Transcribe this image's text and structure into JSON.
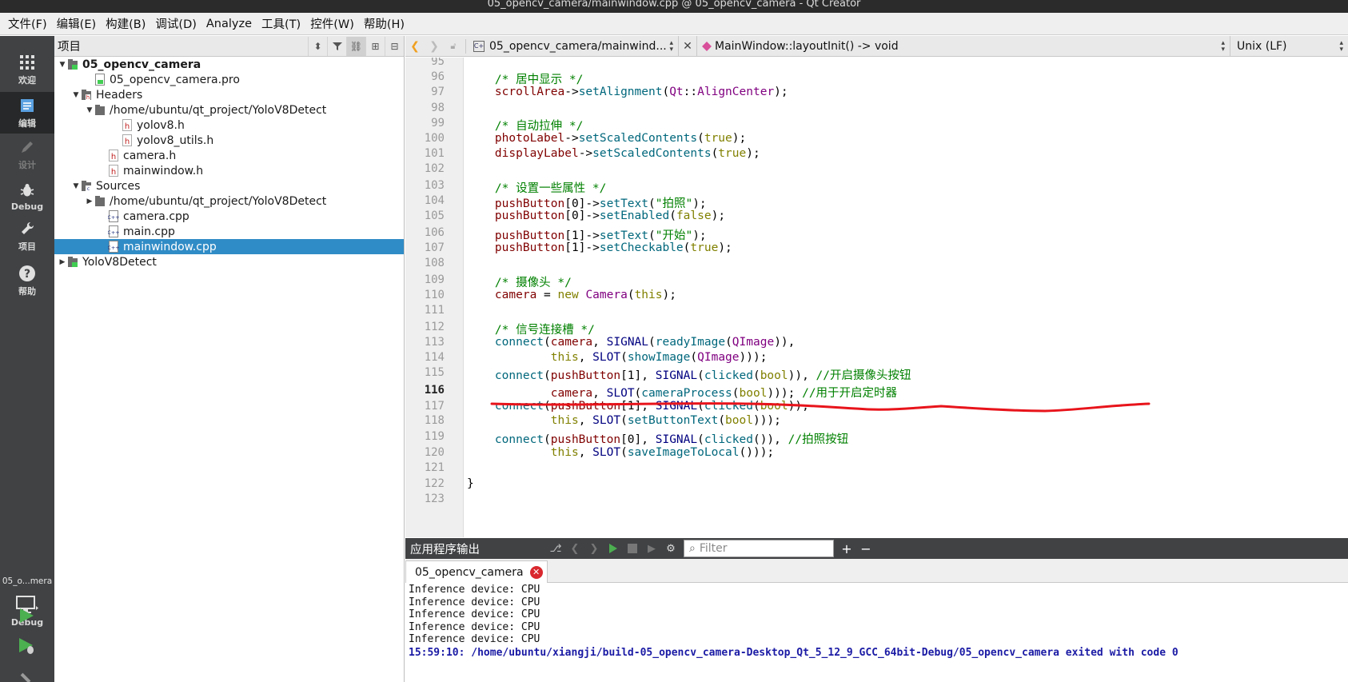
{
  "window": {
    "title": "05_opencv_camera/mainwindow.cpp @ 05_opencv_camera - Qt Creator"
  },
  "menubar": [
    "文件(F)",
    "编辑(E)",
    "构建(B)",
    "调试(D)",
    "Analyze",
    "工具(T)",
    "控件(W)",
    "帮助(H)"
  ],
  "modes": [
    {
      "label": "欢迎",
      "icon": "grid-icon"
    },
    {
      "label": "编辑",
      "icon": "document-icon"
    },
    {
      "label": "设计",
      "icon": "pencil-icon"
    },
    {
      "label": "Debug",
      "icon": "bug-icon"
    },
    {
      "label": "项目",
      "icon": "wrench-icon"
    },
    {
      "label": "帮助",
      "icon": "help-icon"
    }
  ],
  "kit": {
    "name": "05_o...mera",
    "mode": "Debug"
  },
  "project_panel": {
    "title": "项目",
    "tree": [
      {
        "text": "05_opencv_camera",
        "depth": 0,
        "arrow": "down",
        "icon": "project",
        "bold": true
      },
      {
        "text": "05_opencv_camera.pro",
        "depth": 2,
        "arrow": "",
        "icon": "pro"
      },
      {
        "text": "Headers",
        "depth": 1,
        "arrow": "down",
        "icon": "folder-h"
      },
      {
        "text": "/home/ubuntu/qt_project/YoloV8Detect",
        "depth": 2,
        "arrow": "down",
        "icon": "folder"
      },
      {
        "text": "yolov8.h",
        "depth": 4,
        "arrow": "",
        "icon": "h"
      },
      {
        "text": "yolov8_utils.h",
        "depth": 4,
        "arrow": "",
        "icon": "h"
      },
      {
        "text": "camera.h",
        "depth": 3,
        "arrow": "",
        "icon": "h"
      },
      {
        "text": "mainwindow.h",
        "depth": 3,
        "arrow": "",
        "icon": "h"
      },
      {
        "text": "Sources",
        "depth": 1,
        "arrow": "down",
        "icon": "folder-cpp"
      },
      {
        "text": "/home/ubuntu/qt_project/YoloV8Detect",
        "depth": 2,
        "arrow": "right",
        "icon": "folder"
      },
      {
        "text": "camera.cpp",
        "depth": 3,
        "arrow": "",
        "icon": "cpp"
      },
      {
        "text": "main.cpp",
        "depth": 3,
        "arrow": "",
        "icon": "cpp"
      },
      {
        "text": "mainwindow.cpp",
        "depth": 3,
        "arrow": "",
        "icon": "cpp",
        "selected": true
      },
      {
        "text": "YoloV8Detect",
        "depth": 0,
        "arrow": "right",
        "icon": "project"
      }
    ]
  },
  "editor": {
    "file": "05_opencv_camera/mainwind...",
    "symbol": "MainWindow::layoutInit() -> void",
    "line_ending": "Unix (LF)",
    "current_line": 116,
    "lines": [
      {
        "n": 95,
        "parts": []
      },
      {
        "n": 96,
        "parts": [
          [
            "    ",
            ""
          ],
          [
            "/* 居中显示 */",
            "comment"
          ]
        ]
      },
      {
        "n": 97,
        "parts": [
          [
            "    ",
            ""
          ],
          [
            "scrollArea",
            "member"
          ],
          [
            "->",
            ""
          ],
          [
            "setAlignment",
            "func"
          ],
          [
            "(",
            ""
          ],
          [
            "Qt",
            "ns"
          ],
          [
            "::",
            ""
          ],
          [
            "AlignCenter",
            "enum"
          ],
          [
            ");",
            ""
          ]
        ]
      },
      {
        "n": 98,
        "parts": []
      },
      {
        "n": 99,
        "parts": [
          [
            "    ",
            ""
          ],
          [
            "/* 自动拉伸 */",
            "comment"
          ]
        ]
      },
      {
        "n": 100,
        "parts": [
          [
            "    ",
            ""
          ],
          [
            "photoLabel",
            "member"
          ],
          [
            "->",
            ""
          ],
          [
            "setScaledContents",
            "func"
          ],
          [
            "(",
            ""
          ],
          [
            "true",
            "kw"
          ],
          [
            ");",
            ""
          ]
        ]
      },
      {
        "n": 101,
        "parts": [
          [
            "    ",
            ""
          ],
          [
            "displayLabel",
            "member"
          ],
          [
            "->",
            ""
          ],
          [
            "setScaledContents",
            "func"
          ],
          [
            "(",
            ""
          ],
          [
            "true",
            "kw"
          ],
          [
            ");",
            ""
          ]
        ]
      },
      {
        "n": 102,
        "parts": []
      },
      {
        "n": 103,
        "parts": [
          [
            "    ",
            ""
          ],
          [
            "/* 设置一些属性 */",
            "comment"
          ]
        ]
      },
      {
        "n": 104,
        "parts": [
          [
            "    ",
            ""
          ],
          [
            "pushButton",
            "member"
          ],
          [
            "[0]->",
            ""
          ],
          [
            "setText",
            "func"
          ],
          [
            "(",
            ""
          ],
          [
            "\"拍照\"",
            "str"
          ],
          [
            ");",
            ""
          ]
        ]
      },
      {
        "n": 105,
        "parts": [
          [
            "    ",
            ""
          ],
          [
            "pushButton",
            "member"
          ],
          [
            "[0]->",
            ""
          ],
          [
            "setEnabled",
            "func"
          ],
          [
            "(",
            ""
          ],
          [
            "false",
            "kw"
          ],
          [
            ");",
            ""
          ]
        ]
      },
      {
        "n": 106,
        "parts": [
          [
            "    ",
            ""
          ],
          [
            "pushButton",
            "member"
          ],
          [
            "[1]->",
            ""
          ],
          [
            "setText",
            "func"
          ],
          [
            "(",
            ""
          ],
          [
            "\"开始\"",
            "str"
          ],
          [
            ");",
            ""
          ]
        ]
      },
      {
        "n": 107,
        "parts": [
          [
            "    ",
            ""
          ],
          [
            "pushButton",
            "member"
          ],
          [
            "[1]->",
            ""
          ],
          [
            "setCheckable",
            "func"
          ],
          [
            "(",
            ""
          ],
          [
            "true",
            "kw"
          ],
          [
            ");",
            ""
          ]
        ]
      },
      {
        "n": 108,
        "parts": []
      },
      {
        "n": 109,
        "parts": [
          [
            "    ",
            ""
          ],
          [
            "/* 摄像头 */",
            "comment"
          ]
        ]
      },
      {
        "n": 110,
        "parts": [
          [
            "    ",
            ""
          ],
          [
            "camera",
            "member"
          ],
          [
            " = ",
            ""
          ],
          [
            "new",
            "kw"
          ],
          [
            " ",
            ""
          ],
          [
            "Camera",
            "type"
          ],
          [
            "(",
            ""
          ],
          [
            "this",
            "kw"
          ],
          [
            ");",
            ""
          ]
        ]
      },
      {
        "n": 111,
        "parts": []
      },
      {
        "n": 112,
        "parts": [
          [
            "    ",
            ""
          ],
          [
            "/* 信号连接槽 */",
            "comment"
          ]
        ]
      },
      {
        "n": 113,
        "parts": [
          [
            "    ",
            ""
          ],
          [
            "connect",
            "func"
          ],
          [
            "(",
            ""
          ],
          [
            "camera",
            "member"
          ],
          [
            ", ",
            ""
          ],
          [
            "SIGNAL",
            "macro"
          ],
          [
            "(",
            ""
          ],
          [
            "readyImage",
            "func"
          ],
          [
            "(",
            ""
          ],
          [
            "QImage",
            "type"
          ],
          [
            ")),",
            ""
          ]
        ]
      },
      {
        "n": 114,
        "parts": [
          [
            "            ",
            ""
          ],
          [
            "this",
            "kw"
          ],
          [
            ", ",
            ""
          ],
          [
            "SLOT",
            "macro"
          ],
          [
            "(",
            ""
          ],
          [
            "showImage",
            "func"
          ],
          [
            "(",
            ""
          ],
          [
            "QImage",
            "type"
          ],
          [
            ")));",
            ""
          ]
        ]
      },
      {
        "n": 115,
        "parts": [
          [
            "    ",
            ""
          ],
          [
            "connect",
            "func"
          ],
          [
            "(",
            ""
          ],
          [
            "pushButton",
            "member"
          ],
          [
            "[1], ",
            ""
          ],
          [
            "SIGNAL",
            "macro"
          ],
          [
            "(",
            ""
          ],
          [
            "clicked",
            "func"
          ],
          [
            "(",
            ""
          ],
          [
            "bool",
            "kw"
          ],
          [
            ")), ",
            ""
          ],
          [
            "//开启摄像头按钮",
            "comment"
          ]
        ]
      },
      {
        "n": 116,
        "parts": [
          [
            "            ",
            ""
          ],
          [
            "camera",
            "member"
          ],
          [
            ", ",
            ""
          ],
          [
            "SLOT",
            "macro"
          ],
          [
            "(",
            ""
          ],
          [
            "cameraProcess",
            "func"
          ],
          [
            "(",
            ""
          ],
          [
            "bool",
            "kw"
          ],
          [
            ")));",
            ""
          ],
          [
            " ",
            ""
          ],
          [
            "//用于开启定时器",
            "comment"
          ]
        ]
      },
      {
        "n": 117,
        "parts": [
          [
            "    ",
            ""
          ],
          [
            "connect",
            "func"
          ],
          [
            "(",
            ""
          ],
          [
            "pushButton",
            "member"
          ],
          [
            "[1], ",
            ""
          ],
          [
            "SIGNAL",
            "macro"
          ],
          [
            "(",
            ""
          ],
          [
            "clicked",
            "func"
          ],
          [
            "(",
            ""
          ],
          [
            "bool",
            "kw"
          ],
          [
            ")),",
            ""
          ]
        ]
      },
      {
        "n": 118,
        "parts": [
          [
            "            ",
            ""
          ],
          [
            "this",
            "kw"
          ],
          [
            ", ",
            ""
          ],
          [
            "SLOT",
            "macro"
          ],
          [
            "(",
            ""
          ],
          [
            "setButtonText",
            "func"
          ],
          [
            "(",
            ""
          ],
          [
            "bool",
            "kw"
          ],
          [
            ")));",
            ""
          ]
        ]
      },
      {
        "n": 119,
        "parts": [
          [
            "    ",
            ""
          ],
          [
            "connect",
            "func"
          ],
          [
            "(",
            ""
          ],
          [
            "pushButton",
            "member"
          ],
          [
            "[0], ",
            ""
          ],
          [
            "SIGNAL",
            "macro"
          ],
          [
            "(",
            ""
          ],
          [
            "clicked",
            "func"
          ],
          [
            "()), ",
            ""
          ],
          [
            "//拍照按钮",
            "comment"
          ]
        ]
      },
      {
        "n": 120,
        "parts": [
          [
            "            ",
            ""
          ],
          [
            "this",
            "kw"
          ],
          [
            ", ",
            ""
          ],
          [
            "SLOT",
            "macro"
          ],
          [
            "(",
            ""
          ],
          [
            "saveImageToLocal",
            "func"
          ],
          [
            "()));",
            ""
          ]
        ]
      },
      {
        "n": 121,
        "parts": []
      },
      {
        "n": 122,
        "parts": [
          [
            "}",
            ""
          ]
        ]
      },
      {
        "n": 123,
        "parts": []
      }
    ]
  },
  "output": {
    "title": "应用程序输出",
    "filter_placeholder": "Filter",
    "tab_label": "05_opencv_camera",
    "lines": [
      "Inference device: CPU",
      "Inference device: CPU",
      "Inference device: CPU",
      "Inference device: CPU",
      "Inference device: CPU"
    ],
    "exit_line": "15:59:10: /home/ubuntu/xiangji/build-05_opencv_camera-Desktop_Qt_5_12_9_GCC_64bit-Debug/05_opencv_camera exited with code 0"
  },
  "colors": {
    "comment": "#008000",
    "member": "#800000",
    "function": "#00677c",
    "keyword": "#808000",
    "selection": "#308cc6",
    "annotation": "#e8141b",
    "modebar": "#404244"
  }
}
